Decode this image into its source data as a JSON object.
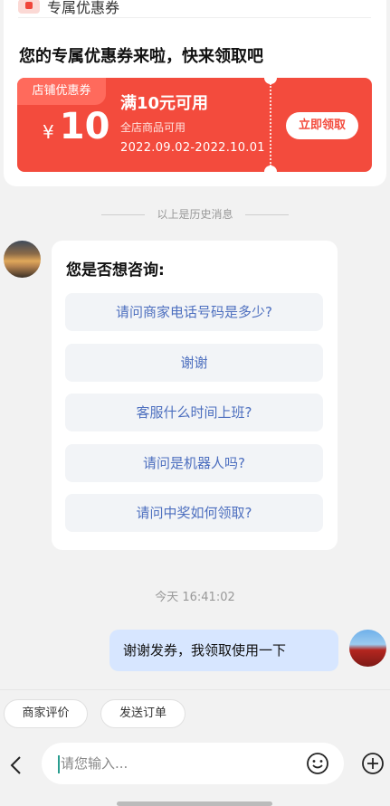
{
  "coupon": {
    "header": "专属优惠券",
    "headline": "您的专属优惠券来啦，快来领取吧",
    "tag": "店铺优惠券",
    "currency": "¥",
    "amount": "10",
    "condition": "满10元可用",
    "scope": "全店商品可用",
    "dates": "2022.09.02-2022.10.01",
    "claim_label": "立即领取"
  },
  "history_label": "以上是历史消息",
  "suggestions": {
    "title": "您是否想咨询:",
    "options": [
      "请问商家电话号码是多少?",
      "谢谢",
      "客服什么时间上班?",
      "请问是机器人吗?",
      "请问中奖如何领取?"
    ]
  },
  "timestamp": "今天 16:41:02",
  "user_message": "谢谢发券，我领取使用一下",
  "quick_actions": [
    "商家评价",
    "发送订单"
  ],
  "input": {
    "placeholder": "请您输入..."
  },
  "colors": {
    "accent": "#f34b3d",
    "link": "#4d6fbf",
    "bubble": "#d7e6ff"
  }
}
